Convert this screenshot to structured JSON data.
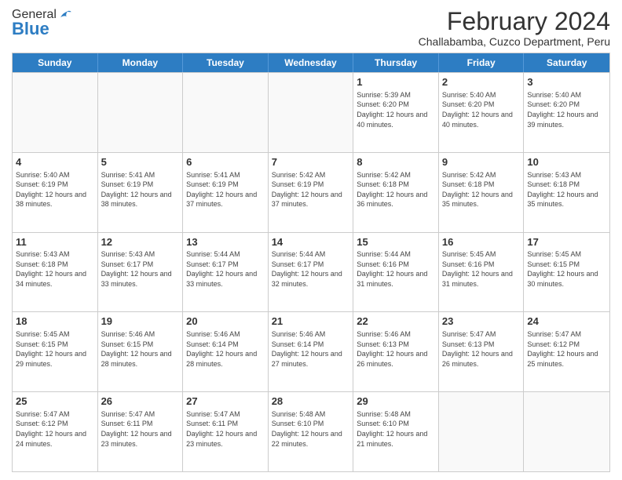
{
  "header": {
    "logo": {
      "general": "General",
      "blue": "Blue"
    },
    "title": "February 2024",
    "subtitle": "Challabamba, Cuzco Department, Peru"
  },
  "calendar": {
    "days_of_week": [
      "Sunday",
      "Monday",
      "Tuesday",
      "Wednesday",
      "Thursday",
      "Friday",
      "Saturday"
    ],
    "weeks": [
      [
        {
          "day": "",
          "info": ""
        },
        {
          "day": "",
          "info": ""
        },
        {
          "day": "",
          "info": ""
        },
        {
          "day": "",
          "info": ""
        },
        {
          "day": "1",
          "info": "Sunrise: 5:39 AM\nSunset: 6:20 PM\nDaylight: 12 hours and 40 minutes."
        },
        {
          "day": "2",
          "info": "Sunrise: 5:40 AM\nSunset: 6:20 PM\nDaylight: 12 hours and 40 minutes."
        },
        {
          "day": "3",
          "info": "Sunrise: 5:40 AM\nSunset: 6:20 PM\nDaylight: 12 hours and 39 minutes."
        }
      ],
      [
        {
          "day": "4",
          "info": "Sunrise: 5:40 AM\nSunset: 6:19 PM\nDaylight: 12 hours and 38 minutes."
        },
        {
          "day": "5",
          "info": "Sunrise: 5:41 AM\nSunset: 6:19 PM\nDaylight: 12 hours and 38 minutes."
        },
        {
          "day": "6",
          "info": "Sunrise: 5:41 AM\nSunset: 6:19 PM\nDaylight: 12 hours and 37 minutes."
        },
        {
          "day": "7",
          "info": "Sunrise: 5:42 AM\nSunset: 6:19 PM\nDaylight: 12 hours and 37 minutes."
        },
        {
          "day": "8",
          "info": "Sunrise: 5:42 AM\nSunset: 6:18 PM\nDaylight: 12 hours and 36 minutes."
        },
        {
          "day": "9",
          "info": "Sunrise: 5:42 AM\nSunset: 6:18 PM\nDaylight: 12 hours and 35 minutes."
        },
        {
          "day": "10",
          "info": "Sunrise: 5:43 AM\nSunset: 6:18 PM\nDaylight: 12 hours and 35 minutes."
        }
      ],
      [
        {
          "day": "11",
          "info": "Sunrise: 5:43 AM\nSunset: 6:18 PM\nDaylight: 12 hours and 34 minutes."
        },
        {
          "day": "12",
          "info": "Sunrise: 5:43 AM\nSunset: 6:17 PM\nDaylight: 12 hours and 33 minutes."
        },
        {
          "day": "13",
          "info": "Sunrise: 5:44 AM\nSunset: 6:17 PM\nDaylight: 12 hours and 33 minutes."
        },
        {
          "day": "14",
          "info": "Sunrise: 5:44 AM\nSunset: 6:17 PM\nDaylight: 12 hours and 32 minutes."
        },
        {
          "day": "15",
          "info": "Sunrise: 5:44 AM\nSunset: 6:16 PM\nDaylight: 12 hours and 31 minutes."
        },
        {
          "day": "16",
          "info": "Sunrise: 5:45 AM\nSunset: 6:16 PM\nDaylight: 12 hours and 31 minutes."
        },
        {
          "day": "17",
          "info": "Sunrise: 5:45 AM\nSunset: 6:15 PM\nDaylight: 12 hours and 30 minutes."
        }
      ],
      [
        {
          "day": "18",
          "info": "Sunrise: 5:45 AM\nSunset: 6:15 PM\nDaylight: 12 hours and 29 minutes."
        },
        {
          "day": "19",
          "info": "Sunrise: 5:46 AM\nSunset: 6:15 PM\nDaylight: 12 hours and 28 minutes."
        },
        {
          "day": "20",
          "info": "Sunrise: 5:46 AM\nSunset: 6:14 PM\nDaylight: 12 hours and 28 minutes."
        },
        {
          "day": "21",
          "info": "Sunrise: 5:46 AM\nSunset: 6:14 PM\nDaylight: 12 hours and 27 minutes."
        },
        {
          "day": "22",
          "info": "Sunrise: 5:46 AM\nSunset: 6:13 PM\nDaylight: 12 hours and 26 minutes."
        },
        {
          "day": "23",
          "info": "Sunrise: 5:47 AM\nSunset: 6:13 PM\nDaylight: 12 hours and 26 minutes."
        },
        {
          "day": "24",
          "info": "Sunrise: 5:47 AM\nSunset: 6:12 PM\nDaylight: 12 hours and 25 minutes."
        }
      ],
      [
        {
          "day": "25",
          "info": "Sunrise: 5:47 AM\nSunset: 6:12 PM\nDaylight: 12 hours and 24 minutes."
        },
        {
          "day": "26",
          "info": "Sunrise: 5:47 AM\nSunset: 6:11 PM\nDaylight: 12 hours and 23 minutes."
        },
        {
          "day": "27",
          "info": "Sunrise: 5:47 AM\nSunset: 6:11 PM\nDaylight: 12 hours and 23 minutes."
        },
        {
          "day": "28",
          "info": "Sunrise: 5:48 AM\nSunset: 6:10 PM\nDaylight: 12 hours and 22 minutes."
        },
        {
          "day": "29",
          "info": "Sunrise: 5:48 AM\nSunset: 6:10 PM\nDaylight: 12 hours and 21 minutes."
        },
        {
          "day": "",
          "info": ""
        },
        {
          "day": "",
          "info": ""
        }
      ]
    ]
  }
}
